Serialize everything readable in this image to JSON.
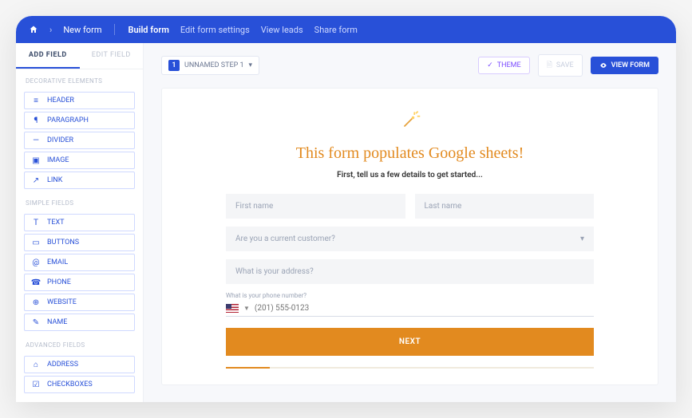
{
  "nav": {
    "breadcrumb": "New form",
    "build": "Build form",
    "settings": "Edit form settings",
    "leads": "View leads",
    "share": "Share form"
  },
  "sidebar": {
    "tab_add": "ADD FIELD",
    "tab_edit": "EDIT FIELD",
    "group_decorative": "DECORATIVE ELEMENTS",
    "group_simple": "SIMPLE FIELDS",
    "group_advanced": "ADVANCED FIELDS",
    "items": {
      "header": "HEADER",
      "paragraph": "PARAGRAPH",
      "divider": "DIVIDER",
      "image": "IMAGE",
      "link": "LINK",
      "text": "TEXT",
      "buttons": "BUTTONS",
      "email": "EMAIL",
      "phone": "PHONE",
      "website": "WEBSITE",
      "name": "NAME",
      "address": "ADDRESS",
      "checkboxes": "CHECKBOXES"
    }
  },
  "toolbar": {
    "step_num": "1",
    "step_label": "UNNAMED STEP 1",
    "theme": "THEME",
    "save": "SAVE",
    "view": "VIEW FORM"
  },
  "form": {
    "title": "This form populates Google sheets!",
    "subtitle": "First, tell us a few details to get started...",
    "first_name_ph": "First name",
    "last_name_ph": "Last name",
    "customer_q": "Are you a current customer?",
    "address_ph": "What is your address?",
    "phone_label": "What is your phone number?",
    "phone_ph": "(201) 555-0123",
    "next": "NEXT"
  },
  "icons": {
    "wand": "✨🪄"
  }
}
